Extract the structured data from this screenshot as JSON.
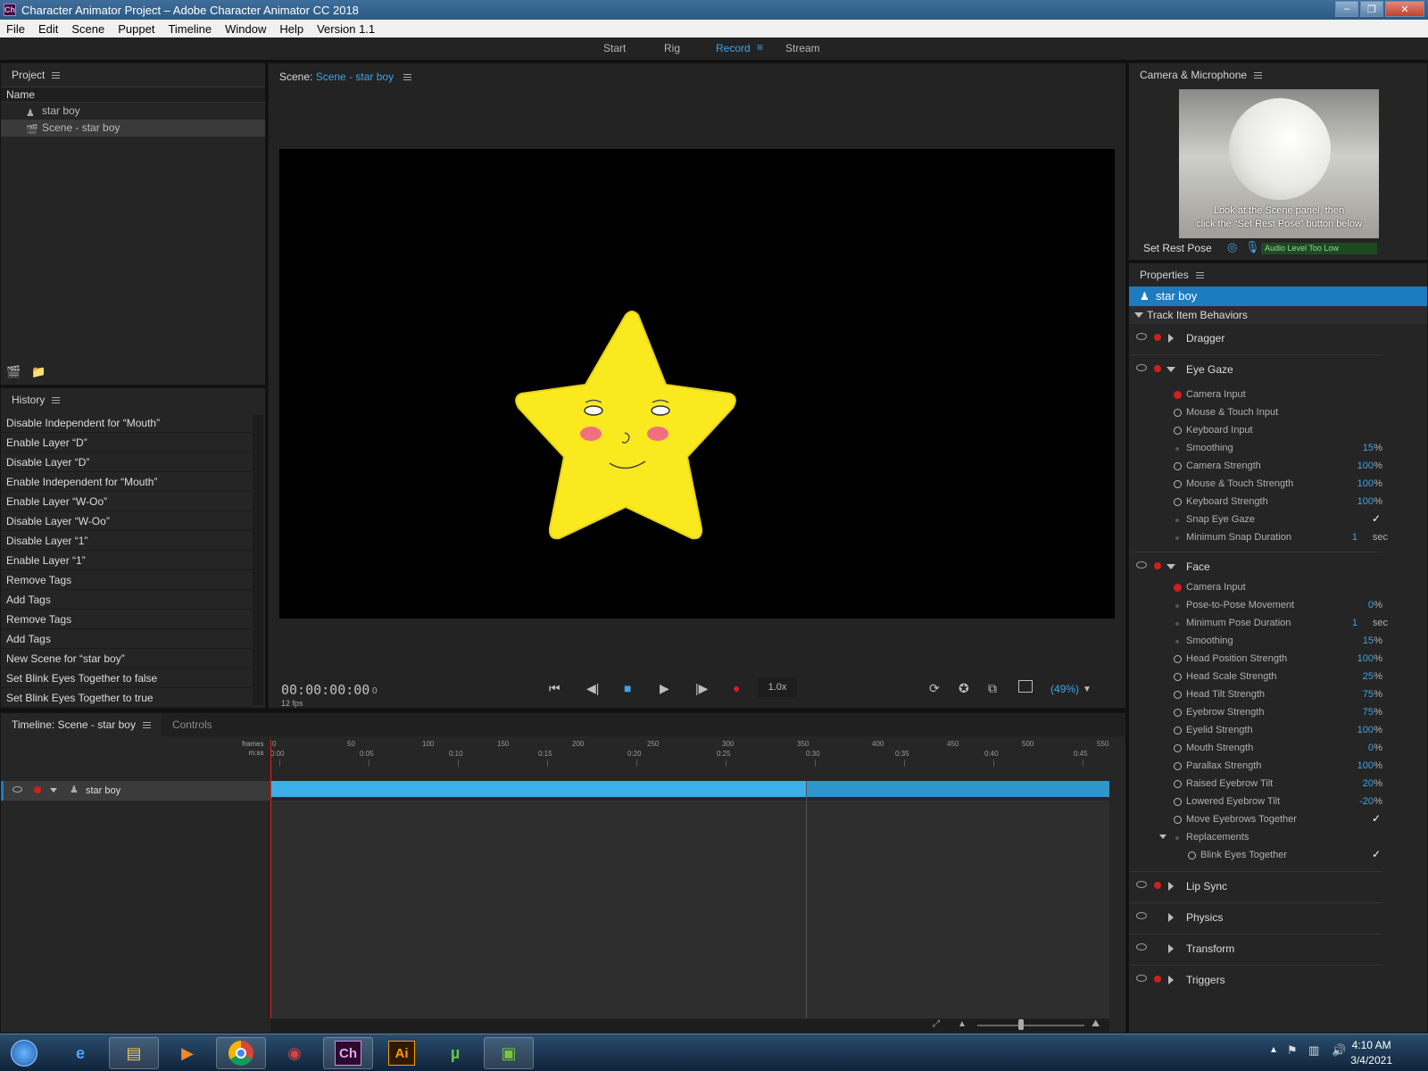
{
  "window": {
    "title": "Character Animator Project – Adobe Character Animator CC 2018",
    "app_icon": "Ch"
  },
  "menu": [
    "File",
    "Edit",
    "Scene",
    "Puppet",
    "Timeline",
    "Window",
    "Help",
    "Version 1.1"
  ],
  "workspaces": {
    "start": "Start",
    "rig": "Rig",
    "record": "Record",
    "stream": "Stream",
    "active": "Record"
  },
  "project": {
    "title": "Project",
    "column": "Name",
    "items": [
      {
        "label": "star boy",
        "icon": "puppet-icon"
      },
      {
        "label": "Scene - star boy",
        "icon": "scene-icon",
        "selected": true
      }
    ]
  },
  "history": {
    "title": "History",
    "items": [
      "Disable Independent for “Mouth”",
      "Enable Layer “D”",
      "Disable Layer “D”",
      "Enable Independent for “Mouth”",
      "Enable Layer “W-Oo”",
      "Disable Layer “W-Oo”",
      "Disable Layer “1”",
      "Enable Layer “1”",
      "Remove Tags",
      "Add Tags",
      "Remove Tags",
      "Add Tags",
      "New Scene for “star boy”",
      "Set Blink Eyes Together to false",
      "Set Blink Eyes Together to true"
    ]
  },
  "scene": {
    "label": "Scene:",
    "name": "Scene - star boy",
    "timecode": "00:00:00:00",
    "frame": "0",
    "fps": "12 fps",
    "speed": "1.0x",
    "zoom": "(49%)"
  },
  "camera": {
    "title": "Camera & Microphone",
    "message_line1": "Look at the Scene panel, then",
    "message_line2": "click the “Set Rest Pose” button below",
    "set_rest_pose": "Set Rest Pose",
    "audio_level": "Audio Level Too Low"
  },
  "properties": {
    "title": "Properties",
    "puppet": "star boy",
    "section": "Track Item Behaviors",
    "dragger": "Dragger",
    "eye_gaze": {
      "label": "Eye Gaze",
      "camera_input": "Camera Input",
      "mouse_touch_input": "Mouse & Touch Input",
      "keyboard_input": "Keyboard Input",
      "smoothing": {
        "name": "Smoothing",
        "value": "15",
        "unit": "%"
      },
      "camera_strength": {
        "name": "Camera Strength",
        "value": "100",
        "unit": "%"
      },
      "mouse_touch_strength": {
        "name": "Mouse & Touch Strength",
        "value": "100",
        "unit": "%"
      },
      "keyboard_strength": {
        "name": "Keyboard Strength",
        "value": "100",
        "unit": "%"
      },
      "snap_eye_gaze": "Snap Eye Gaze",
      "min_snap_duration": {
        "name": "Minimum Snap Duration",
        "value": "1",
        "unit": "sec"
      }
    },
    "face": {
      "label": "Face",
      "camera_input": "Camera Input",
      "pose_movement": {
        "name": "Pose-to-Pose Movement",
        "value": "0",
        "unit": "%"
      },
      "min_pose_duration": {
        "name": "Minimum Pose Duration",
        "value": "1",
        "unit": "sec"
      },
      "smoothing": {
        "name": "Smoothing",
        "value": "15",
        "unit": "%"
      },
      "head_position": {
        "name": "Head Position Strength",
        "value": "100",
        "unit": "%"
      },
      "head_scale": {
        "name": "Head Scale Strength",
        "value": "25",
        "unit": "%"
      },
      "head_tilt": {
        "name": "Head Tilt Strength",
        "value": "75",
        "unit": "%"
      },
      "eyebrow": {
        "name": "Eyebrow Strength",
        "value": "75",
        "unit": "%"
      },
      "eyelid": {
        "name": "Eyelid Strength",
        "value": "100",
        "unit": "%"
      },
      "mouth": {
        "name": "Mouth Strength",
        "value": "0",
        "unit": "%"
      },
      "parallax": {
        "name": "Parallax Strength",
        "value": "100",
        "unit": "%"
      },
      "raised_tilt": {
        "name": "Raised Eyebrow Tilt",
        "value": "20",
        "unit": "%"
      },
      "lowered_tilt": {
        "name": "Lowered Eyebrow Tilt",
        "value": "-20",
        "unit": "%"
      },
      "move_eyebrows": "Move Eyebrows Together",
      "replacements": "Replacements",
      "blink_eyes": "Blink Eyes Together"
    },
    "lip_sync": "Lip Sync",
    "physics": "Physics",
    "transform": "Transform",
    "triggers": "Triggers",
    "check": "✓"
  },
  "timeline": {
    "tab": "Timeline: Scene - star boy",
    "controls_tab": "Controls",
    "legend_frames": "frames",
    "legend_time": "m:ss",
    "frame_ticks": [
      "0",
      "50",
      "100",
      "150",
      "200",
      "250",
      "300",
      "350",
      "400",
      "450",
      "500",
      "550"
    ],
    "time_ticks": [
      "0:00",
      "0:05",
      "0:10",
      "0:15",
      "0:20",
      "0:25",
      "0:30",
      "0:35",
      "0:40",
      "0:45"
    ],
    "track": "star boy"
  },
  "taskbar": {
    "time": "4:10 AM",
    "date": "3/4/2021",
    "ch": "Ch",
    "ai": "Ai"
  }
}
